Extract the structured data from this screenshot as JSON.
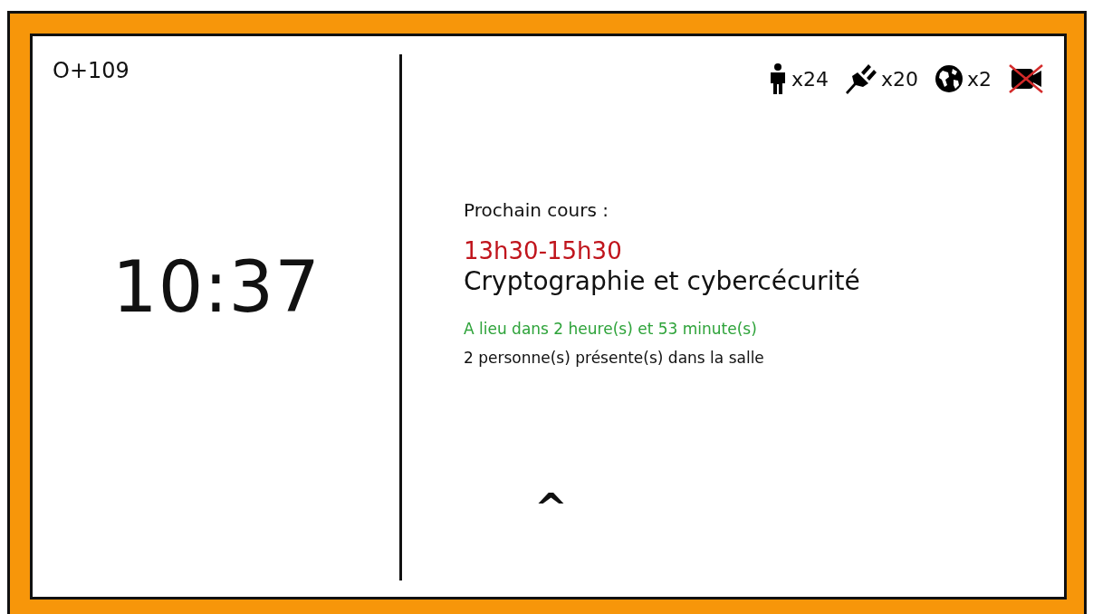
{
  "room": "O+109",
  "clock": "10:37",
  "amenities": [
    {
      "kind": "person",
      "count": "x24",
      "available": true
    },
    {
      "kind": "plug",
      "count": "x20",
      "available": true
    },
    {
      "kind": "globe",
      "count": "x2",
      "available": true
    },
    {
      "kind": "camera",
      "available": false
    }
  ],
  "next_course": {
    "heading": "Prochain cours :",
    "time": "13h30-15h30",
    "title": "Cryptographie et cybercécurité",
    "countdown": "A lieu dans 2 heure(s) et 53 minute(s)",
    "presence": "2 personne(s) présente(s) dans la salle"
  },
  "expand_button": "^"
}
